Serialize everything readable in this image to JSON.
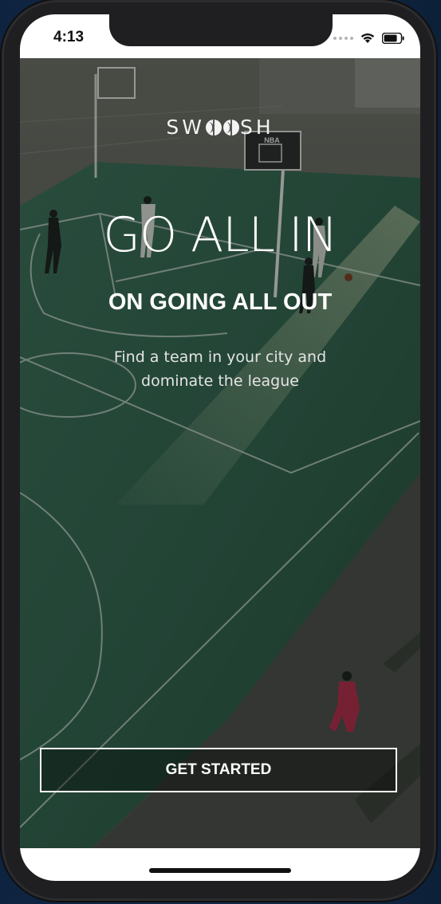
{
  "status_bar": {
    "time": "4:13",
    "icons": [
      "cellular-signal-icon",
      "wifi-icon",
      "battery-icon"
    ]
  },
  "brand": {
    "prefix": "SW",
    "suffix": "SH",
    "logo_icons": [
      "basketball-icon",
      "basketball-icon"
    ]
  },
  "hero": {
    "headline": "GO ALL IN",
    "subheadline": "ON GOING ALL OUT",
    "tagline": "Find a team in your city and dominate the league",
    "backboard_text": "NBA"
  },
  "cta": {
    "label": "GET STARTED"
  },
  "colors": {
    "court_green": "#2e5a45",
    "text": "#ffffff",
    "button_border": "#ffffff"
  }
}
